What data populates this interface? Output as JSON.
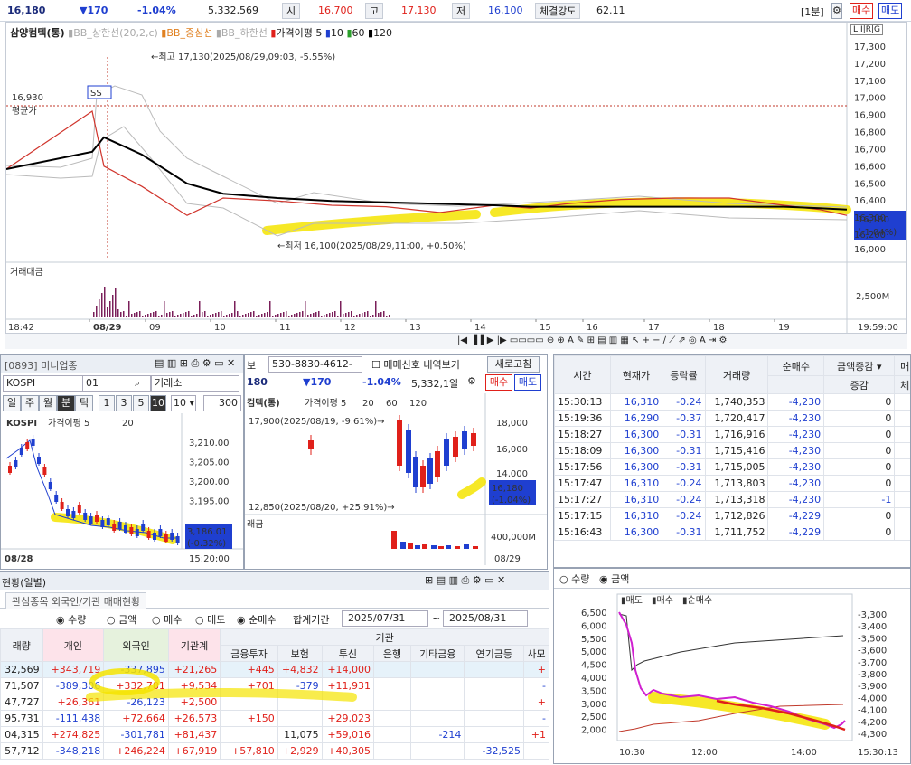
{
  "top": {
    "price": "16,180",
    "change": "▼170",
    "pct": "-1.04%",
    "volume": "5,332,569",
    "open_label": "시",
    "open": "16,700",
    "high_label": "고",
    "high": "17,130",
    "low_label": "저",
    "low": "16,100",
    "strength_label": "체결강도",
    "strength": "62.11",
    "interval": "[1분]",
    "buy": "매수",
    "sell": "매도"
  },
  "main_chart": {
    "legend": {
      "name": "삼양컴텍(통)",
      "bb_upper": "BB_상한선(20,2,c)",
      "bb_mid": "BB_중심선",
      "bb_lower": "BB_하한선",
      "ma": "가격이평 5",
      "ma10": "10",
      "ma60": "60",
      "ma120": "120"
    },
    "high_note": "←최고 17,130(2025/08/29,09:03, -5.55%)",
    "low_note": "←최저 16,100(2025/08/29,11:00, +0.50%)",
    "avg_price": "16,930",
    "avg_label": "평균가",
    "current_label_1": "16,180",
    "current_label_2": "(-1.04%)",
    "lirg": "L|I|R|G",
    "y_ticks": [
      "17,300",
      "17,200",
      "17,100",
      "17,000",
      "16,900",
      "16,800",
      "16,700",
      "16,600",
      "16,500",
      "16,400",
      "16,300",
      "16,200",
      "16,000"
    ],
    "volume_title": "거래대금",
    "volume_tick": "2,500M",
    "x_ticks": [
      "18:42",
      "08/29",
      "09",
      "10",
      "11",
      "12",
      "13",
      "14",
      "15",
      "16",
      "17",
      "18",
      "19",
      "19:59:00"
    ]
  },
  "chart_data": {
    "type": "line",
    "title": "삼양컴텍(통)",
    "x": [
      "09:00",
      "09:30",
      "10:00",
      "10:30",
      "11:00",
      "11:30",
      "12:00",
      "12:30",
      "13:00",
      "13:30",
      "14:00",
      "14:30",
      "15:00",
      "15:30",
      "16:00",
      "17:00",
      "18:00",
      "19:00",
      "19:59"
    ],
    "series": [
      {
        "name": "가격",
        "values": [
          16500,
          16900,
          16520,
          16380,
          16180,
          16300,
          16280,
          16250,
          16240,
          16200,
          16250,
          16230,
          16260,
          16290,
          16300,
          16300,
          16250,
          16220,
          16180
        ]
      },
      {
        "name": "120",
        "values": [
          16500,
          16620,
          16720,
          16600,
          16400,
          16330,
          16300,
          16280,
          16270,
          16260,
          16250,
          16240,
          16240,
          16240,
          16240,
          16240,
          16240,
          16230,
          16220
        ]
      }
    ],
    "ylim": [
      15950,
      17350
    ]
  },
  "mini_kospi": {
    "title": "[0893] 미니업종",
    "index": "KOSPI",
    "code": "01",
    "exchange": "거래소",
    "periods": [
      "일",
      "주",
      "월",
      "분",
      "틱"
    ],
    "steps": [
      "1",
      "3",
      "5",
      "10"
    ],
    "sel_step": "10",
    "count": "300",
    "legend_name": "KOSPI",
    "legend_ma": "가격이평 5",
    "legend_ma2": "20",
    "y_ticks": [
      "3,210.00",
      "3,205.00",
      "3,200.00",
      "3,195.00"
    ],
    "current_1": "3,186.01",
    "current_2": "(-0.32%)",
    "x_start": "08/28",
    "x_end": "15:20:00"
  },
  "daily_chart": {
    "account": "530-8830-4612-",
    "signal": "매매신호 내역보기",
    "refresh": "새로고침",
    "price": "180",
    "change": "▼170",
    "pct": "-1.04%",
    "volume": "5,332,1일",
    "buy": "매수",
    "sell": "매도",
    "legend_name": "컴텍(통)",
    "legend_ma": "가격이평 5",
    "ma20": "20",
    "ma60": "60",
    "ma120": "120",
    "high_note": "17,900(2025/08/19, -9.61%)→",
    "low_note": "12,850(2025/08/20, +25.91%)→",
    "y_ticks": [
      "18,000",
      "16,000",
      "14,000",
      "13,000"
    ],
    "current_1": "16,180",
    "current_2": "(-1.04%)",
    "vol_title": "래금",
    "vol_tick": "400,000M",
    "x_end": "08/29"
  },
  "trades": {
    "headers": [
      "시간",
      "현재가",
      "등락률",
      "거래량",
      "순매수",
      "증감",
      "체"
    ],
    "select": "금액증감",
    "extra": "매",
    "rows": [
      [
        "15:30:13",
        "16,310",
        "-0.24",
        "1,740,353",
        "-4,230",
        "0"
      ],
      [
        "15:19:36",
        "16,290",
        "-0.37",
        "1,720,417",
        "-4,230",
        "0"
      ],
      [
        "15:18:27",
        "16,300",
        "-0.31",
        "1,716,916",
        "-4,230",
        "0"
      ],
      [
        "15:18:09",
        "16,300",
        "-0.31",
        "1,715,416",
        "-4,230",
        "0"
      ],
      [
        "15:17:56",
        "16,300",
        "-0.31",
        "1,715,005",
        "-4,230",
        "0"
      ],
      [
        "15:17:47",
        "16,310",
        "-0.24",
        "1,713,803",
        "-4,230",
        "0"
      ],
      [
        "15:17:27",
        "16,310",
        "-0.24",
        "1,713,318",
        "-4,230",
        "-1"
      ],
      [
        "15:17:15",
        "16,310",
        "-0.24",
        "1,712,826",
        "-4,229",
        "0"
      ],
      [
        "15:16:43",
        "16,300",
        "-0.31",
        "1,711,752",
        "-4,229",
        "0"
      ]
    ]
  },
  "flow_chart": {
    "radio1": "수량",
    "radio2": "금액",
    "legend": [
      "매도",
      "매수",
      "순매수"
    ],
    "y_left": [
      "6,500",
      "6,000",
      "5,500",
      "5,000",
      "4,500",
      "4,000",
      "3,500",
      "3,000",
      "2,500",
      "2,000"
    ],
    "y_right": [
      "-3,300",
      "-3,400",
      "-3,500",
      "-3,600",
      "-3,700",
      "-3,800",
      "-3,900",
      "-4,000",
      "-4,100",
      "-4,200",
      "-4,300"
    ],
    "x_ticks": [
      "10:30",
      "12:00",
      "14:00",
      "15:30:13"
    ]
  },
  "investor": {
    "title": "현황(일별)",
    "tab": "관심종목 외국인/기관 매매현황",
    "radio": [
      "수량",
      "금액"
    ],
    "radio2": [
      "매수",
      "매도",
      "순매수"
    ],
    "period_label": "합계기간",
    "date_from": "2025/07/31",
    "date_to": "2025/08/31",
    "headers": [
      "래량",
      "개인",
      "외국인",
      "기관계",
      "금융투자",
      "보험",
      "투신",
      "은행",
      "기타금융",
      "연기금등",
      "사모"
    ],
    "group": "기관",
    "rows": [
      [
        "32,569",
        "+343,719",
        "-337,895",
        "+21,265",
        "+445",
        "+4,832",
        "+14,000",
        "",
        "",
        "",
        "+"
      ],
      [
        "71,507",
        "-389,306",
        "+332,781",
        "+9,534",
        "+701",
        "-379",
        "+11,931",
        "",
        "",
        "",
        "-"
      ],
      [
        "47,727",
        "+26,361",
        "-26,123",
        "+2,500",
        "",
        "",
        "",
        "",
        "",
        "",
        "+"
      ],
      [
        "95,731",
        "-111,438",
        "+72,664",
        "+26,573",
        "+150",
        "",
        "+29,023",
        "",
        "",
        "",
        "-"
      ],
      [
        "04,315",
        "+274,825",
        "-301,781",
        "+81,437",
        "",
        "11,075",
        "+59,016",
        "",
        "-214",
        "",
        "+1"
      ],
      [
        "57,712",
        "-348,218",
        "+246,224",
        "+67,919",
        "+57,810",
        "+2,929",
        "+40,305",
        "",
        "",
        "-32,525",
        ""
      ]
    ]
  }
}
